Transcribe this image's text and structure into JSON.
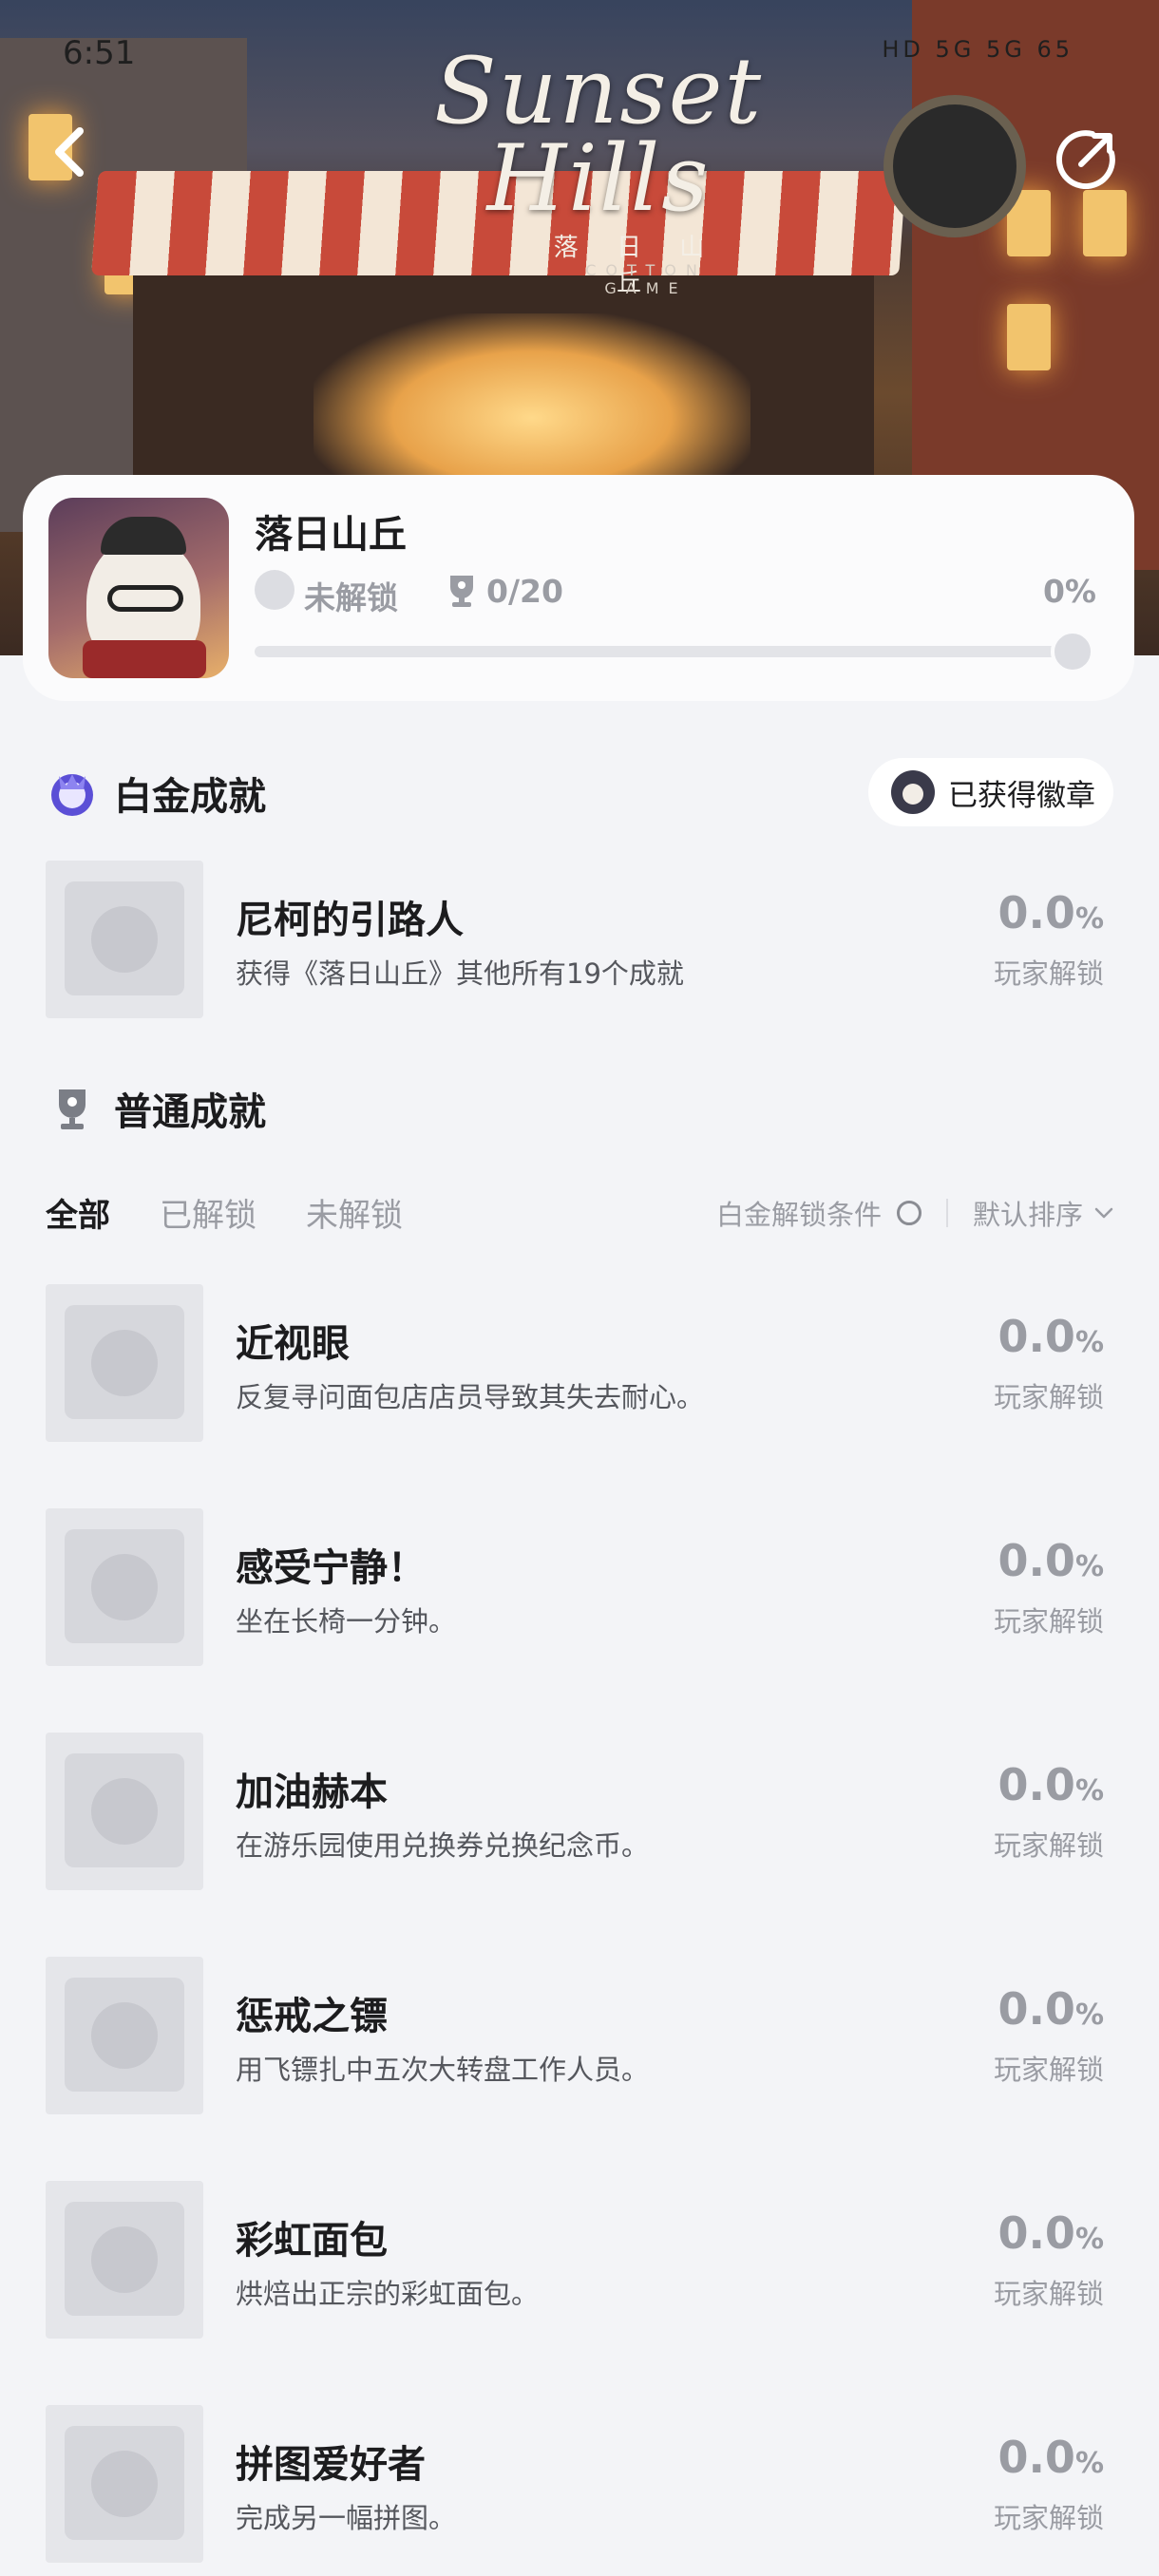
{
  "status_bar": {
    "time": "6:51",
    "indicators": "HD 5G 5G 65"
  },
  "hero": {
    "logo_line1": "Sunset",
    "logo_line2": "Hills",
    "logo_subtitle": "落 日 山 丘",
    "logo_studio": "COTTON GAME",
    "back_icon": "chevron-left-icon",
    "share_icon": "share-icon"
  },
  "game": {
    "name": "落日山丘",
    "unlock_status": "未解锁",
    "achievement_count": "0/20",
    "progress_percent": "0%",
    "progress_value": 0
  },
  "platinum": {
    "section_title": "白金成就",
    "badge_button_label": "已获得徽章",
    "item": {
      "name": "尼柯的引路人",
      "desc": "获得《落日山丘》其他所有19个成就",
      "pct": "0.0",
      "pct_suffix": "%",
      "pct_label": "玩家解锁"
    }
  },
  "normal": {
    "section_title": "普通成就",
    "tabs": [
      "全部",
      "已解锁",
      "未解锁"
    ],
    "filter_condition": "白金解锁条件",
    "sort_label": "默认排序",
    "items": [
      {
        "name": "近视眼",
        "desc": "反复寻问面包店店员导致其失去耐心。",
        "pct": "0.0",
        "pct_suffix": "%",
        "pct_label": "玩家解锁"
      },
      {
        "name": "感受宁静！",
        "desc": "坐在长椅一分钟。",
        "pct": "0.0",
        "pct_suffix": "%",
        "pct_label": "玩家解锁"
      },
      {
        "name": "加油赫本",
        "desc": "在游乐园使用兑换券兑换纪念币。",
        "pct": "0.0",
        "pct_suffix": "%",
        "pct_label": "玩家解锁"
      },
      {
        "name": "惩戒之镖",
        "desc": "用飞镖扎中五次大转盘工作人员。",
        "pct": "0.0",
        "pct_suffix": "%",
        "pct_label": "玩家解锁"
      },
      {
        "name": "彩虹面包",
        "desc": "烘焙出正宗的彩虹面包。",
        "pct": "0.0",
        "pct_suffix": "%",
        "pct_label": "玩家解锁"
      },
      {
        "name": "拼图爱好者",
        "desc": "完成另一幅拼图。",
        "pct": "0.0",
        "pct_suffix": "%",
        "pct_label": "玩家解锁"
      }
    ]
  }
}
